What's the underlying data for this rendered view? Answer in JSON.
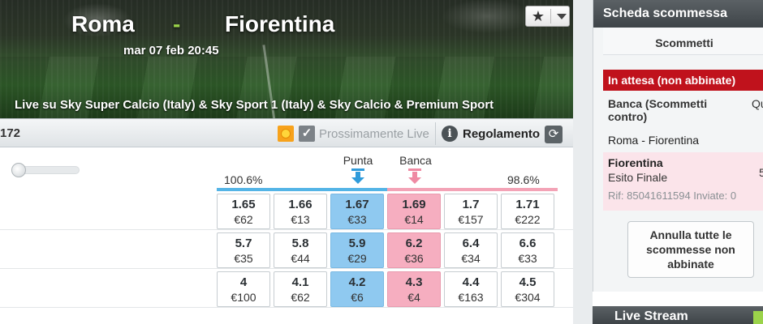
{
  "header": {
    "home_team": "Roma",
    "separator": "-",
    "away_team": "Fiorentina",
    "kickoff": "mar 07 feb 20:45",
    "broadcast": "Live su Sky Super Calcio (Italy) & Sky Sport 1 (Italy) & Sky Calcio & Premium Sport",
    "favourite_icon": "star-icon"
  },
  "toolbar": {
    "market_id": "172",
    "coming_soon_label": "Prossimamente Live",
    "rules_label": "Regolamento",
    "info_icon": "i",
    "refresh_icon": "⟳"
  },
  "odds": {
    "back_label": "Punta",
    "lay_label": "Banca",
    "back_overround": "100.6%",
    "lay_overround": "98.6%",
    "back_color": "#8fc9f0",
    "lay_color": "#f6aec0",
    "rows": [
      {
        "runner": "",
        "cells": [
          {
            "price": "1.65",
            "size": "€62"
          },
          {
            "price": "1.66",
            "size": "€13"
          },
          {
            "price": "1.67",
            "size": "€33"
          },
          {
            "price": "1.69",
            "size": "€14"
          },
          {
            "price": "1.7",
            "size": "€157"
          },
          {
            "price": "1.71",
            "size": "€222"
          }
        ]
      },
      {
        "runner": "",
        "cells": [
          {
            "price": "5.7",
            "size": "€35"
          },
          {
            "price": "5.8",
            "size": "€44"
          },
          {
            "price": "5.9",
            "size": "€29"
          },
          {
            "price": "6.2",
            "size": "€36"
          },
          {
            "price": "6.4",
            "size": "€34"
          },
          {
            "price": "6.6",
            "size": "€33"
          }
        ]
      },
      {
        "runner": "",
        "cells": [
          {
            "price": "4",
            "size": "€100"
          },
          {
            "price": "4.1",
            "size": "€62"
          },
          {
            "price": "4.2",
            "size": "€6"
          },
          {
            "price": "4.3",
            "size": "€4"
          },
          {
            "price": "4.4",
            "size": "€163"
          },
          {
            "price": "4.5",
            "size": "€304"
          }
        ]
      }
    ]
  },
  "betslip": {
    "title": "Scheda scommessa",
    "tab": "Scommetti",
    "unmatched_header": "In attesa (non abbinate)",
    "lay_column": "Banca (Scommetti contro)",
    "odds_column": "Quota scommessa",
    "event": "Roma - Fiorentina",
    "selection": "Fiorentina",
    "market": "Esito Finale",
    "odds_value": "5",
    "reference": "Rif: 85041611594  Inviate: 0",
    "cancel_all": "Annulla tutte le scommesse non abbinate"
  },
  "live_stream": {
    "title": "Live Stream"
  }
}
